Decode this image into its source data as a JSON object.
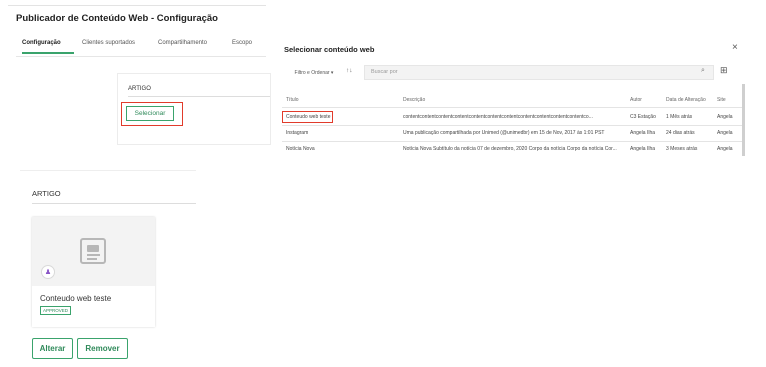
{
  "config_page": {
    "title": "Publicador de Conteúdo Web - Configuração",
    "tabs": [
      "Configuração",
      "Clientes suportados",
      "Compartilhamento",
      "Escopo"
    ],
    "article_label": "ARTIGO",
    "select_button": "Selecionar"
  },
  "modal": {
    "title": "Selecionar conteúdo web",
    "close": "×",
    "filter_label": "Filtro e Ordenar ▾",
    "sort_icon": "↑↓",
    "search_placeholder": "Buscar por",
    "search_icon": "⌕",
    "grid_icon": "⊞",
    "columns": [
      "Título",
      "Descrição",
      "Autor",
      "Data de Alteração",
      "Site"
    ],
    "rows": [
      [
        "Conteudo web teste",
        "contentcontentcontentcontentcontentcontentcontentcontentcontentcontentcontentco...",
        "C3 Estação",
        "1 Mês atrás",
        "Angela"
      ],
      [
        "Instagram",
        " Uma publicação compartilhada por Unimed (@unimedbr) em 15 de Nov, 2017 às 1:01 PST",
        "Angela Ilha",
        "24 dias atrás",
        "Angela"
      ],
      [
        "Notícia Nova",
        "Notícia Nova Subtítulo da notícia 07 de dezembro, 2020 Corpo da notícia Corpo da notícia Cor...",
        "Angela Ilha",
        "3 Meses atrás",
        "Angela"
      ]
    ]
  },
  "article_panel": {
    "label": "ARTIGO",
    "content_title": "Conteudo web teste",
    "status_badge": "APPROVED",
    "avatar_icon": "♟",
    "change_button": "Alterar",
    "remove_button": "Remover"
  },
  "colors": {
    "accent": "#3aa36c",
    "highlight": "#e13b2b"
  }
}
